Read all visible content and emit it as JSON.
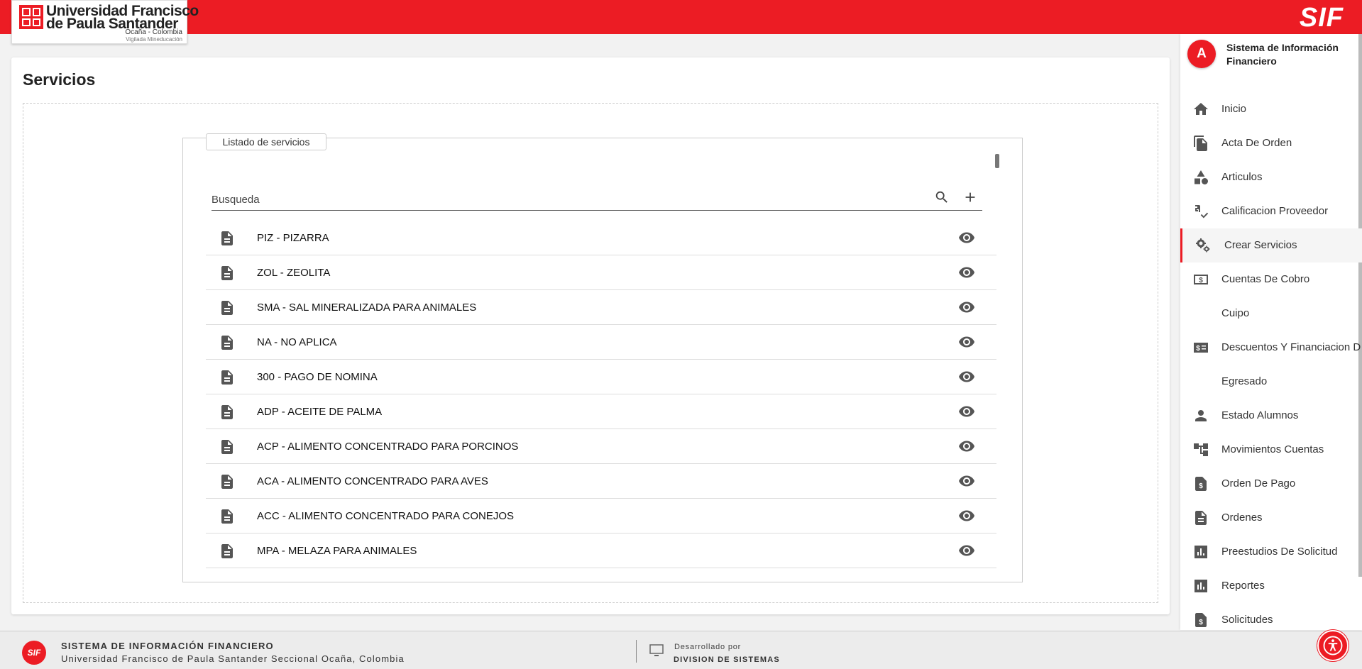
{
  "header": {
    "logo": {
      "line1": "Universidad Francisco",
      "line2": "de Paula Santander",
      "line3": "Ocaña - Colombia",
      "line4": "Vigilada Mineducación"
    },
    "brand": "SIF"
  },
  "page": {
    "title": "Servicios",
    "panel_legend": "Listado de servicios",
    "search": {
      "placeholder": "Busqueda",
      "value": ""
    },
    "items": [
      {
        "label": "PIZ - PIZARRA"
      },
      {
        "label": "ZOL - ZEOLITA"
      },
      {
        "label": "SMA - SAL MINERALIZADA PARA ANIMALES"
      },
      {
        "label": "NA - NO APLICA"
      },
      {
        "label": "300 - PAGO DE NOMINA"
      },
      {
        "label": "ADP - ACEITE DE PALMA"
      },
      {
        "label": "ACP - ALIMENTO CONCENTRADO PARA PORCINOS"
      },
      {
        "label": "ACA - ALIMENTO CONCENTRADO PARA AVES"
      },
      {
        "label": "ACC - ALIMENTO CONCENTRADO PARA CONEJOS"
      },
      {
        "label": "MPA - MELAZA PARA ANIMALES"
      }
    ]
  },
  "sidebar": {
    "avatar_letter": "A",
    "title": "Sistema de Información Financiero",
    "items": [
      {
        "label": "Inicio",
        "icon": "home-icon"
      },
      {
        "label": "Acta De Orden",
        "icon": "copy-icon"
      },
      {
        "label": "Articulos",
        "icon": "category-icon"
      },
      {
        "label": "Calificacion Proveedor",
        "icon": "rule-icon"
      },
      {
        "label": "Crear Servicios",
        "icon": "gears-icon",
        "active": true
      },
      {
        "label": "Cuentas De Cobro",
        "icon": "money-icon"
      },
      {
        "label": "Cuipo",
        "icon": ""
      },
      {
        "label": "Descuentos Y Financiacion D",
        "icon": "price-icon"
      },
      {
        "label": "Egresado",
        "icon": ""
      },
      {
        "label": "Estado Alumnos",
        "icon": "person-icon"
      },
      {
        "label": "Movimientos Cuentas",
        "icon": "tree-icon"
      },
      {
        "label": "Orden De Pago",
        "icon": "request-quote-icon"
      },
      {
        "label": "Ordenes",
        "icon": "description-icon"
      },
      {
        "label": "Preestudios De Solicitud",
        "icon": "analytics-icon"
      },
      {
        "label": "Reportes",
        "icon": "bar-chart-icon"
      },
      {
        "label": "Solicitudes",
        "icon": "request-quote-icon"
      }
    ]
  },
  "footer": {
    "title": "SISTEMA DE INFORMACIÓN FINANCIERO",
    "subtitle": "Universidad Francisco de Paula Santander Seccional Ocaña, Colombia",
    "logo_text": "SIF",
    "dev_label": "Desarrollado por",
    "dev_name": "DIVISION DE SISTEMAS"
  },
  "colors": {
    "brand_red": "#ec1c24"
  }
}
